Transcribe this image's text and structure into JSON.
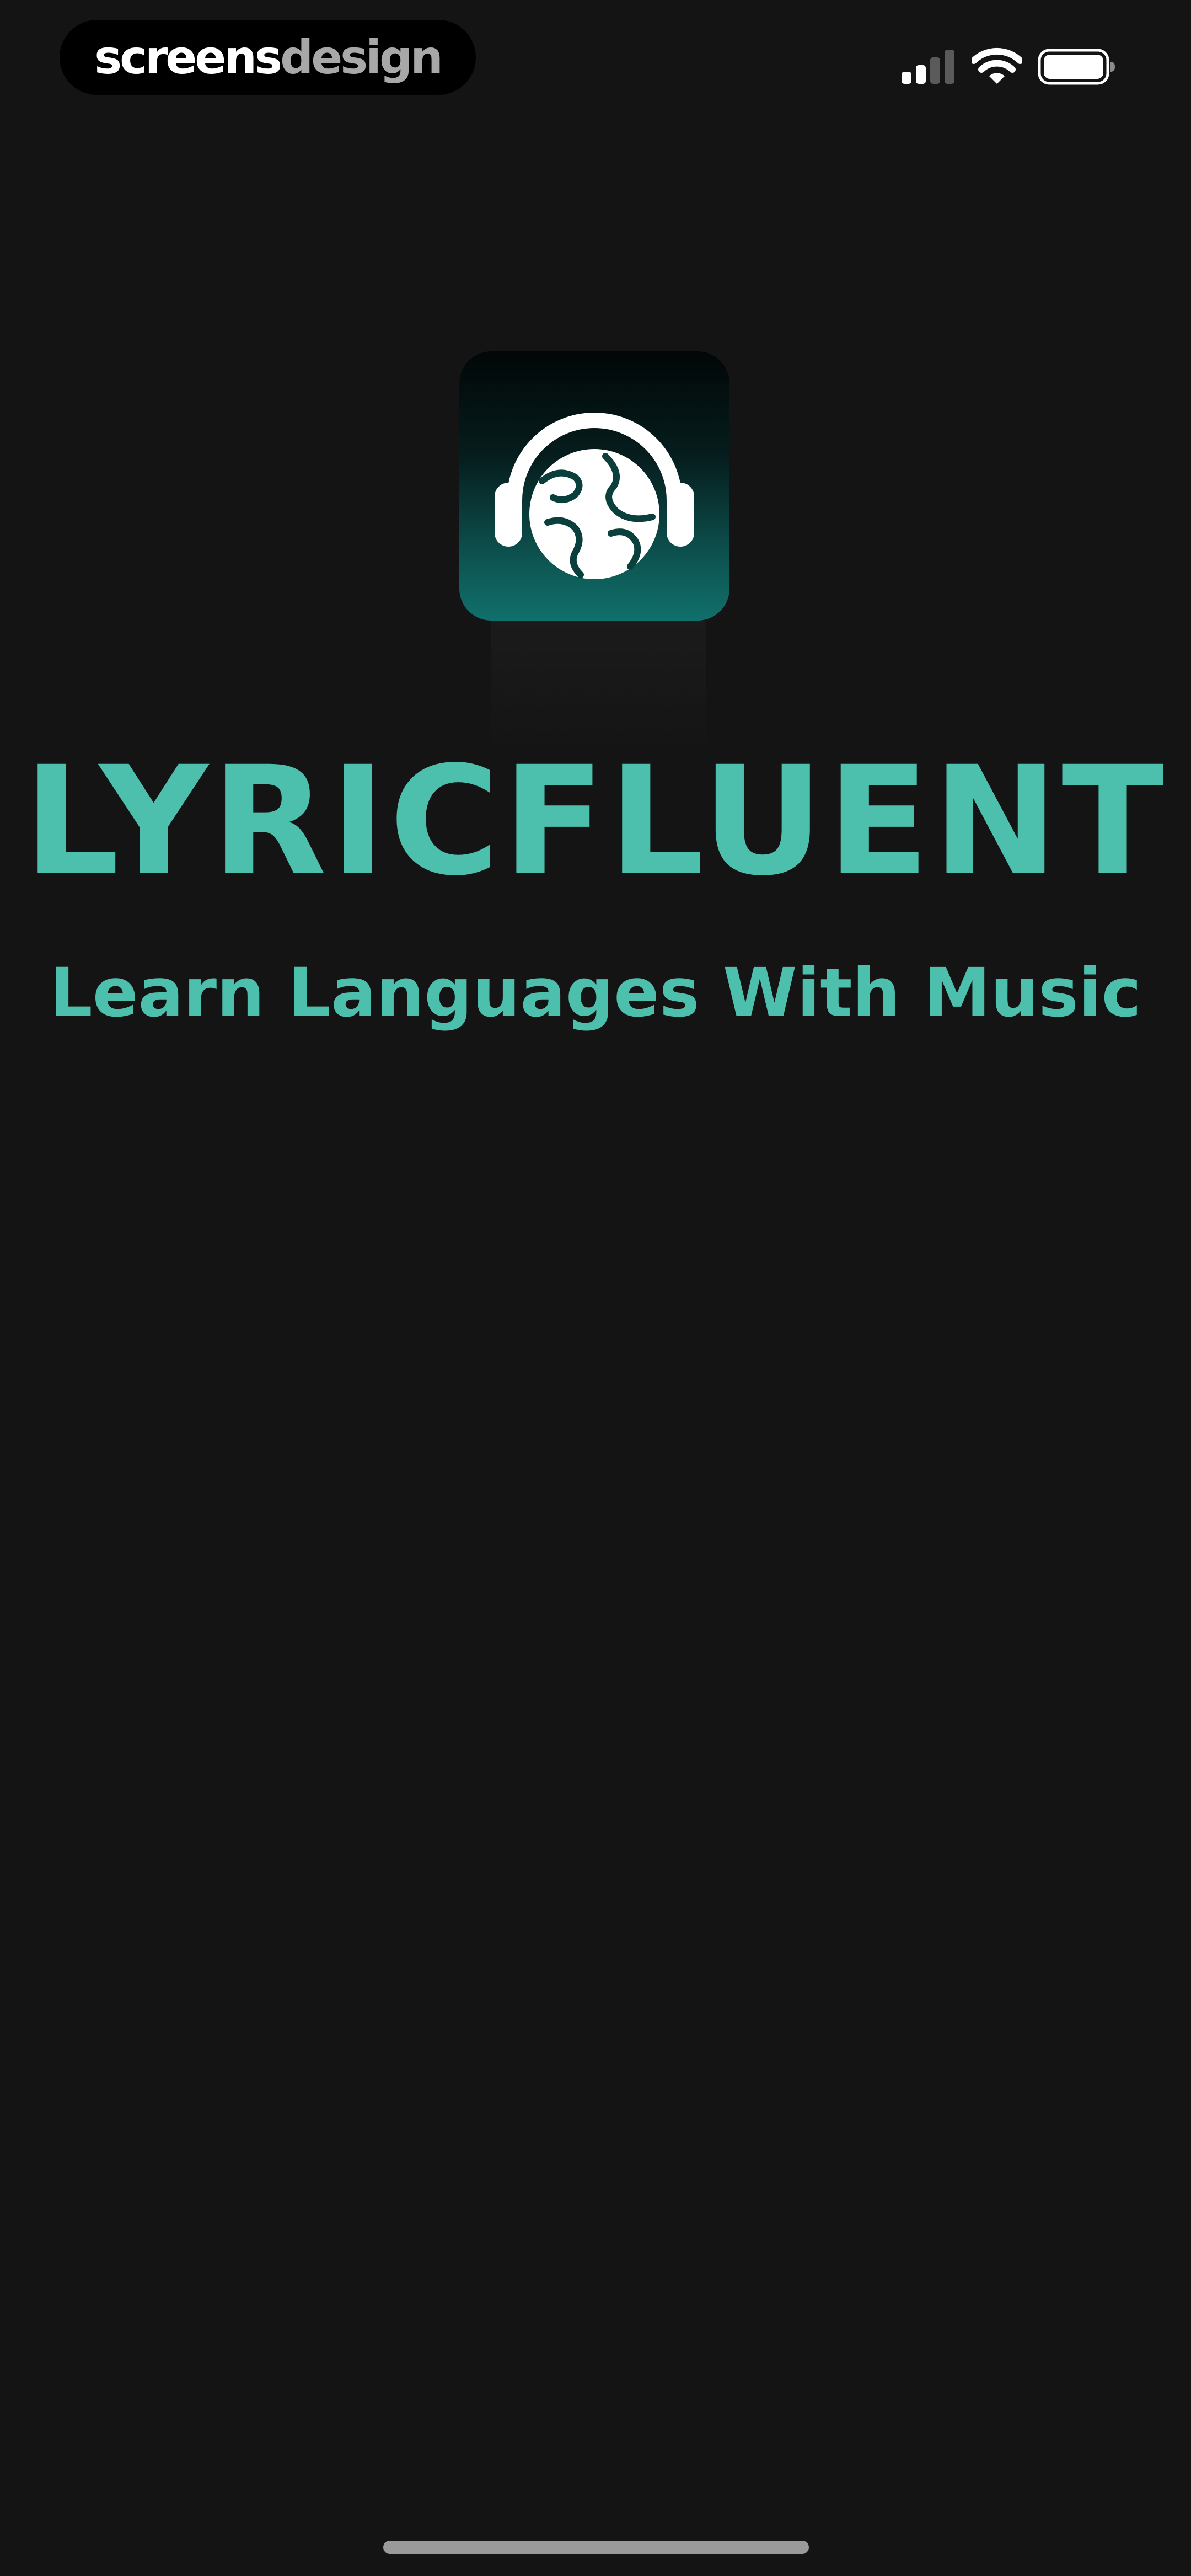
{
  "status_bar": {
    "brand_part1": "screens",
    "brand_part2": "design",
    "signal_icon": "cellular-signal-icon",
    "wifi_icon": "wifi-icon",
    "battery_icon": "battery-icon"
  },
  "splash": {
    "icon": "headphones-globe-icon",
    "title": "LYRICFLUENT",
    "tagline": "Learn Languages With Music"
  },
  "colors": {
    "background": "#141414",
    "accent": "#4dbfad",
    "icon_gradient_bottom": "#10706b"
  }
}
